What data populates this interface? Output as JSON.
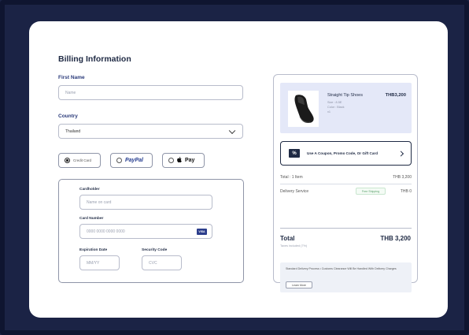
{
  "billing": {
    "title": "Billing Information",
    "first_name_label": "First Name",
    "first_name_placeholder": "Name",
    "country_label": "Country",
    "country_value": "Thailand"
  },
  "payment": {
    "credit_card_label": "Credit Card",
    "paypal_label": "PayPal",
    "applepay_label": "Pay",
    "selected": "credit_card"
  },
  "card": {
    "cardholder_label": "Cardholder",
    "cardholder_placeholder": "Name on card",
    "number_label": "Card Number",
    "number_placeholder": "0000 0000 0000 0000",
    "brand_badge": "VISA",
    "expiration_label": "Expiration Date",
    "expiration_placeholder": "MM/YY",
    "security_label": "Security Code",
    "security_placeholder": "CVC"
  },
  "summary": {
    "product_name": "Straight Tip Shoes",
    "product_price": "THB3,200",
    "product_meta": [
      "Size : 8.5E",
      "Color : Black",
      "x1"
    ],
    "coupon_text": "Use A Coupon, Promo Code, Or Gift Card",
    "coupon_icon": "%",
    "subtotal_label": "Total : 1 Item",
    "subtotal_value": "THB 3,200",
    "delivery_label": "Delivery Service",
    "delivery_tag": "Free Shipping",
    "delivery_value": "THB 0",
    "total_label": "Total",
    "total_value": "THB 3,200",
    "total_note": "Taxes included (7%)",
    "notice_text": "Standard Delivery Process • Customs Clearance Will Be Handled With Delivery Charges",
    "learn_more": "Learn More"
  },
  "colors": {
    "background": "#1b2345",
    "card": "#ffffff",
    "accent": "#1f2a44",
    "product_bg": "#e4e8f8"
  }
}
